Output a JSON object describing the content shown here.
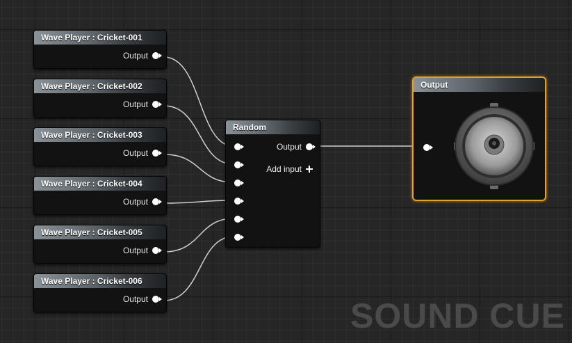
{
  "wave_players": [
    {
      "title": "Wave Player : Cricket-001",
      "output_label": "Output"
    },
    {
      "title": "Wave Player : Cricket-002",
      "output_label": "Output"
    },
    {
      "title": "Wave Player : Cricket-003",
      "output_label": "Output"
    },
    {
      "title": "Wave Player : Cricket-004",
      "output_label": "Output"
    },
    {
      "title": "Wave Player : Cricket-005",
      "output_label": "Output"
    },
    {
      "title": "Wave Player : Cricket-006",
      "output_label": "Output"
    }
  ],
  "random_node": {
    "title": "Random",
    "output_label": "Output",
    "add_input_label": "Add input"
  },
  "output_node": {
    "title": "Output"
  },
  "watermark": "SOUND CUE",
  "colors": {
    "selection_outline": "#e5a02a",
    "wire": "#d0d0d0",
    "pin": "#ffffff"
  }
}
